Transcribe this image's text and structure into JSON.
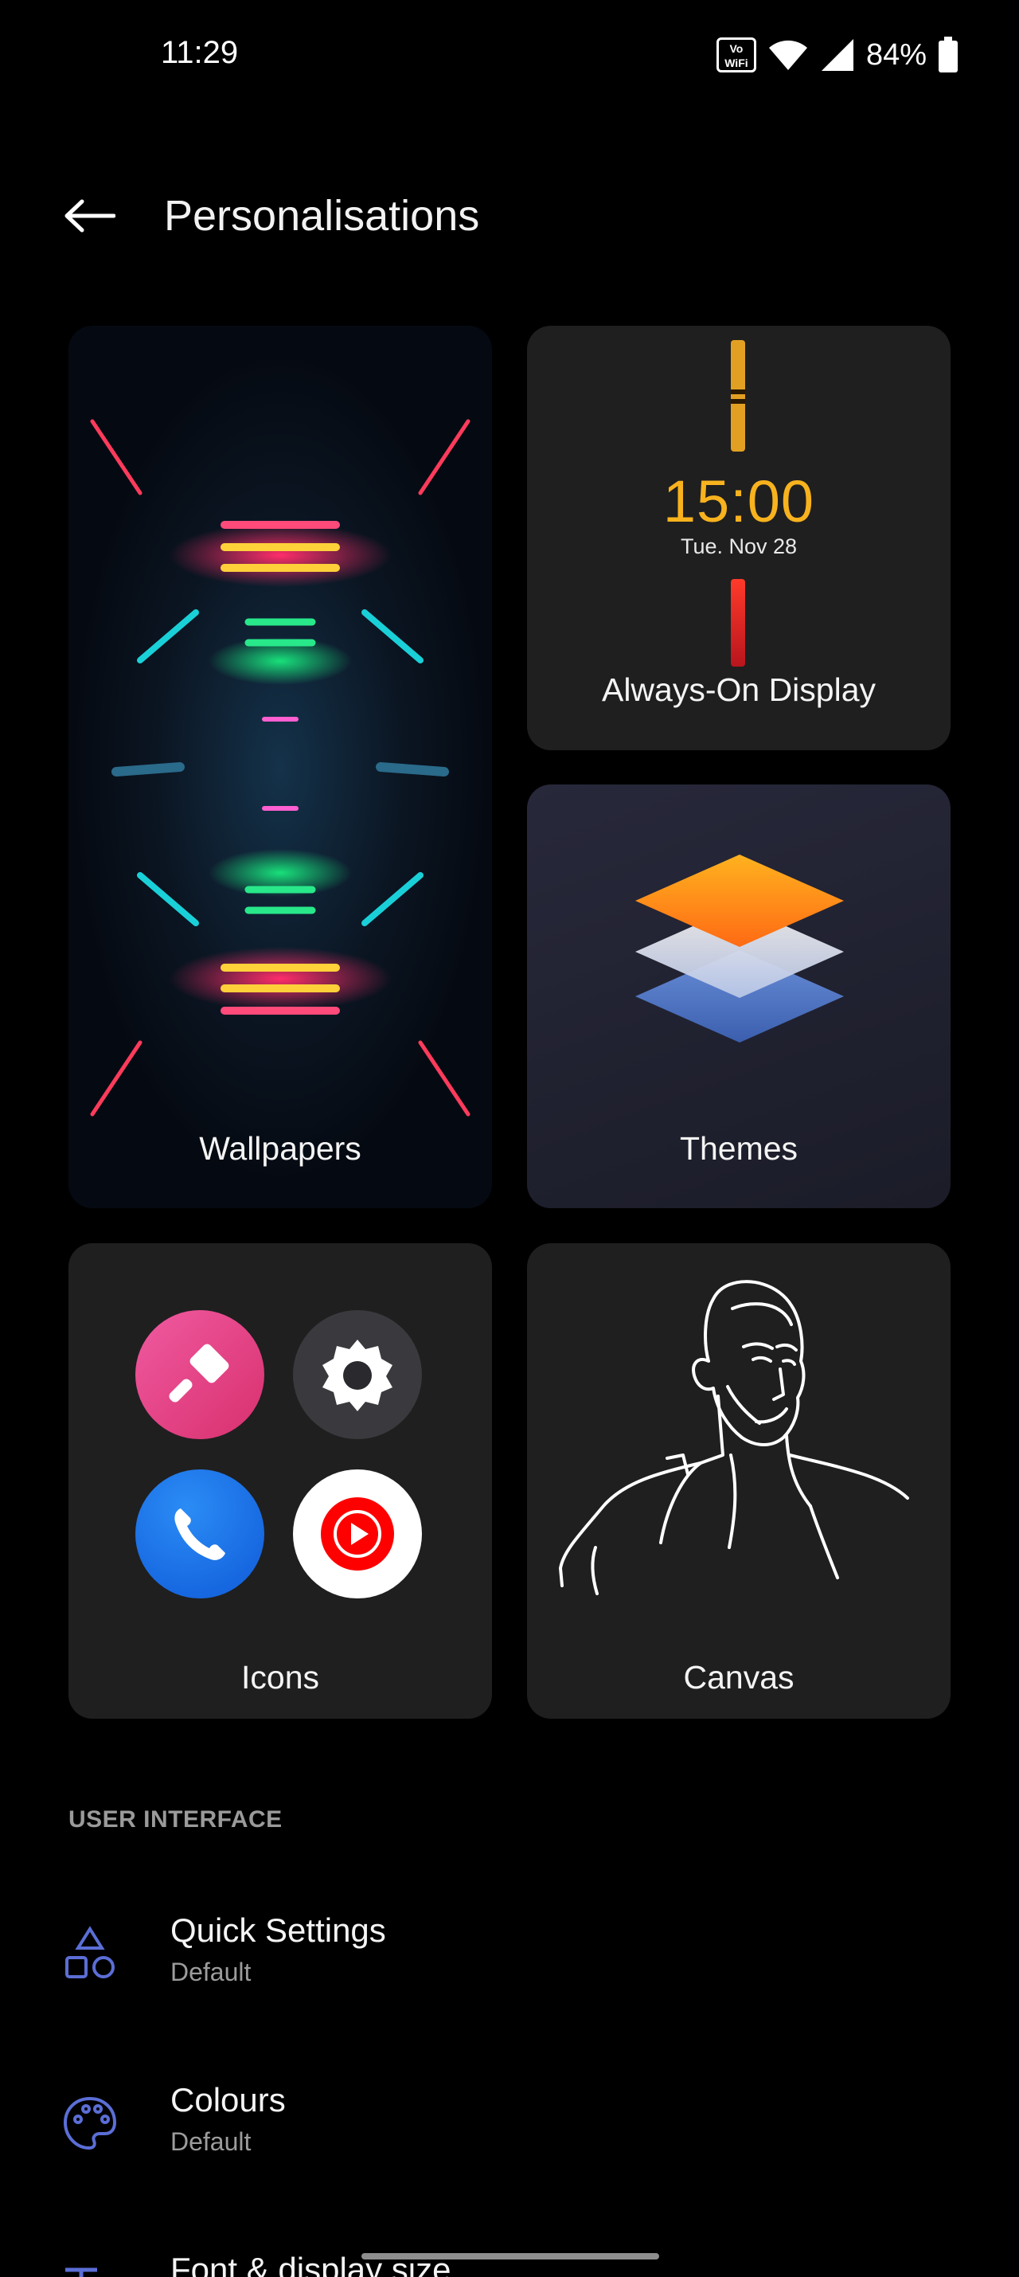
{
  "status_bar": {
    "time": "11:29",
    "volte_label": "Vo WiFi",
    "battery": "84%"
  },
  "header": {
    "title": "Personalisations",
    "back_icon": "back-arrow-icon"
  },
  "tiles": {
    "wallpapers": {
      "label": "Wallpapers"
    },
    "aod": {
      "label": "Always-On Display",
      "time": "15:00",
      "date": "Tue. Nov 28",
      "accent": "#f7b21e"
    },
    "themes": {
      "label": "Themes"
    },
    "icons": {
      "label": "Icons",
      "apps": [
        "brush-icon",
        "settings-icon",
        "phone-icon",
        "youtube-music-icon"
      ]
    },
    "canvas": {
      "label": "Canvas"
    }
  },
  "section": {
    "header": "USER INTERFACE"
  },
  "list": [
    {
      "title": "Quick Settings",
      "subtitle": "Default",
      "icon": "shapes-icon"
    },
    {
      "title": "Colours",
      "subtitle": "Default",
      "icon": "palette-icon"
    },
    {
      "title": "Font & display size",
      "icon": "font-size-icon"
    }
  ],
  "colors": {
    "background": "#000000",
    "tile": "#1f1f1f",
    "icon_accent": "#5b6ed6"
  }
}
